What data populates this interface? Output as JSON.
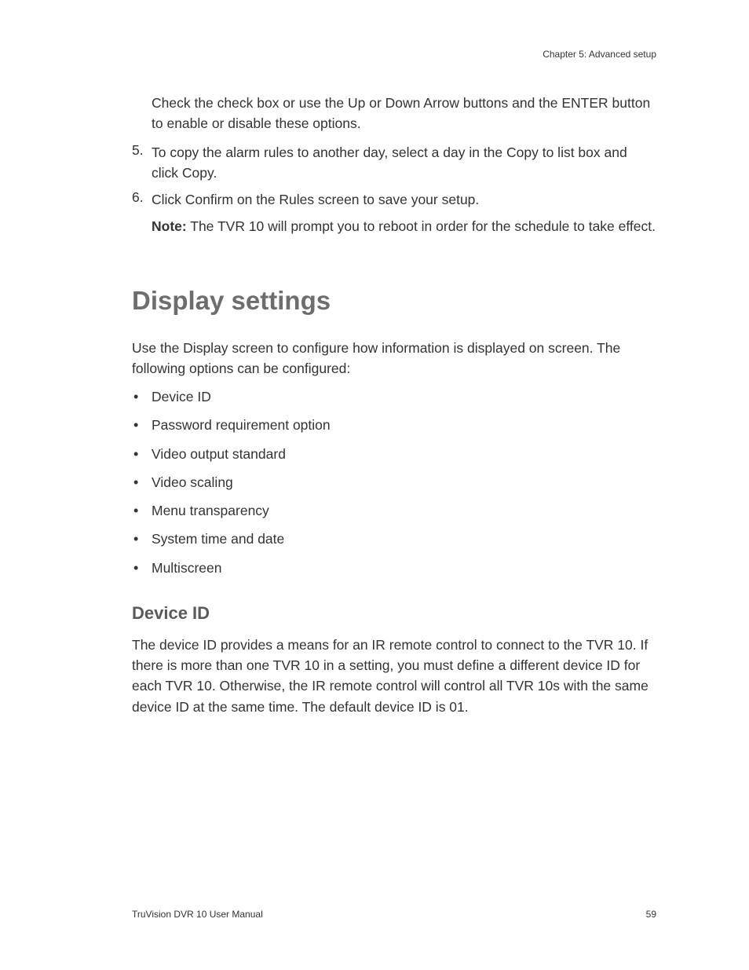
{
  "header": {
    "chapter": "Chapter 5: Advanced setup"
  },
  "body": {
    "intro_para": "Check the check box or use the Up or Down Arrow buttons and the ENTER button to enable or disable these options.",
    "step5_num": "5.",
    "step5_text": "To copy the alarm rules to another day, select a day in the Copy to list box and click Copy.",
    "step6_num": "6.",
    "step6_text": "Click Confirm on the Rules screen to save your setup.",
    "note_label": "Note:",
    "note_text": " The TVR 10 will prompt you to reboot in order for the schedule to take effect."
  },
  "section": {
    "heading": "Display settings",
    "intro": "Use the Display screen to configure how information is displayed on screen. The following options can be configured:",
    "bullets": {
      "b0": "Device ID",
      "b1": "Password requirement option",
      "b2": "Video output standard",
      "b3": "Video scaling",
      "b4": "Menu transparency",
      "b5": "System time and date",
      "b6": "Multiscreen"
    }
  },
  "subsection": {
    "heading": "Device ID",
    "para": "The device ID provides a means for an IR remote control to connect to the TVR 10. If there is more than one TVR 10 in a setting, you must define a different device ID for each TVR 10. Otherwise, the IR remote control will control all TVR 10s with the same device ID at the same time. The default device ID is 01."
  },
  "footer": {
    "manual": "TruVision DVR 10 User Manual",
    "page": "59"
  }
}
